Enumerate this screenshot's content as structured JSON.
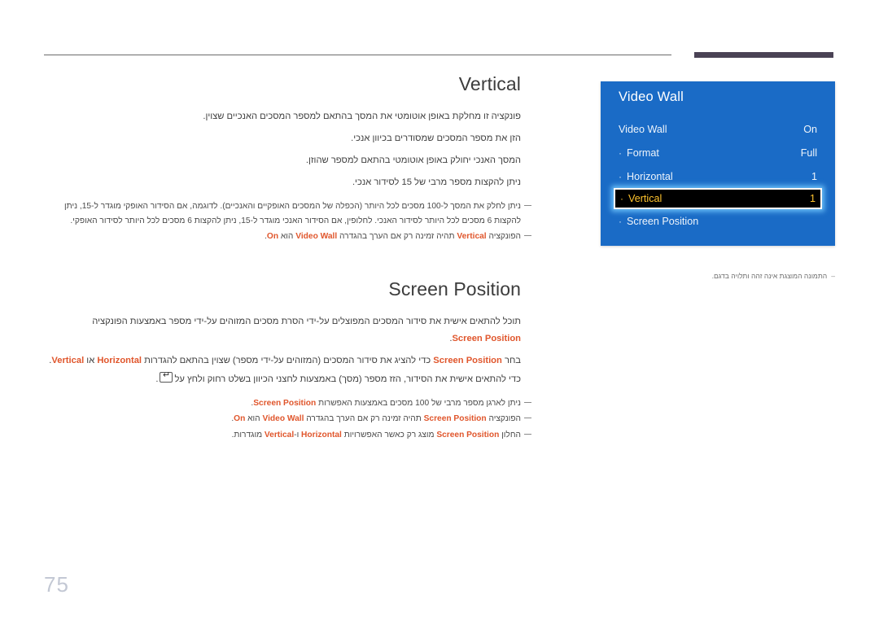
{
  "page": {
    "number": "75"
  },
  "sections": [
    {
      "title": "Vertical",
      "paragraphs": [
        "פונקציה זו מחלקת באופן אוטומטי את המסך בהתאם למספר המסכים האנכיים שצוין.",
        "הזן את מספר המסכים שמסודרים בכיוון אנכי.",
        "המסך האנכי יחולק באופן אוטומטי בהתאם למספר שהוזן.",
        "ניתן להקצות מספר מרבי של 15 לסידור אנכי."
      ],
      "notes": [
        "ניתן לחלק את המסך ל-100 מסכים לכל היותר (הכפלה של המסכים האופקיים והאנכיים). לדוגמה, אם הסידור האופקי מוגדר ל-15, ניתן להקצות 6 מסכים לכל היותר לסידור האנכי. לחלופין, אם הסידור האנכי מוגדר ל-15, ניתן להקצות 6 מסכים לכל היותר לסידור האופקי.",
        "הפונקציה Vertical תהיה זמינה רק אם הערך בהגדרה Video Wall הוא On."
      ]
    },
    {
      "title": "Screen Position",
      "paragraphs": [
        "תוכל להתאים אישית את סידור המסכים המפוצלים על-ידי הסרת מסכים המזוהים על-ידי מספר באמצעות הפונקציה Screen Position.",
        "בחר Screen Position כדי להציג את סידור המסכים (המזוהים על-ידי מספר) שצוין בהתאם להגדרות Horizontal או Vertical.",
        "כדי להתאים אישית את הסידור, הזז מספר (מסך) באמצעות לחצני הכיוון בשלט רחוק ולחץ על"
      ],
      "notes": [
        "ניתן לארגן מספר מרבי של 100 מסכים באמצעות האפשרות Screen Position.",
        "הפונקציה Screen Position תהיה זמינה רק אם הערך בהגדרה Video Wall הוא On.",
        "החלון Screen Position מוצג רק כאשר האפשרויות Horizontal ו-Vertical מוגדרות."
      ]
    }
  ],
  "osd": {
    "title": "Video Wall",
    "rows": [
      {
        "label": "Video Wall",
        "value": "On",
        "sub": false,
        "selected": false
      },
      {
        "label": "Format",
        "value": "Full",
        "sub": true,
        "selected": false
      },
      {
        "label": "Horizontal",
        "value": "1",
        "sub": true,
        "selected": false
      },
      {
        "label": "Vertical",
        "value": "1",
        "sub": true,
        "selected": true
      },
      {
        "label": "Screen Position",
        "value": "",
        "sub": true,
        "selected": false
      }
    ],
    "note": "התמונה המוצגת אינה זהה ותלויה בדגם.",
    "note_dash": "–",
    "bullet_dot": "·",
    "colors": {
      "panel_blue": "#1a6bc6",
      "selected_bg": "#000000",
      "selected_text": "#ffc42e",
      "selected_glow": "#78cdff"
    }
  },
  "theme": {
    "accent_orange": "#e0562c",
    "rule_dark": "#4a4255",
    "rule_light": "#6b6b6b",
    "page_number_color": "#c3c8d4"
  }
}
